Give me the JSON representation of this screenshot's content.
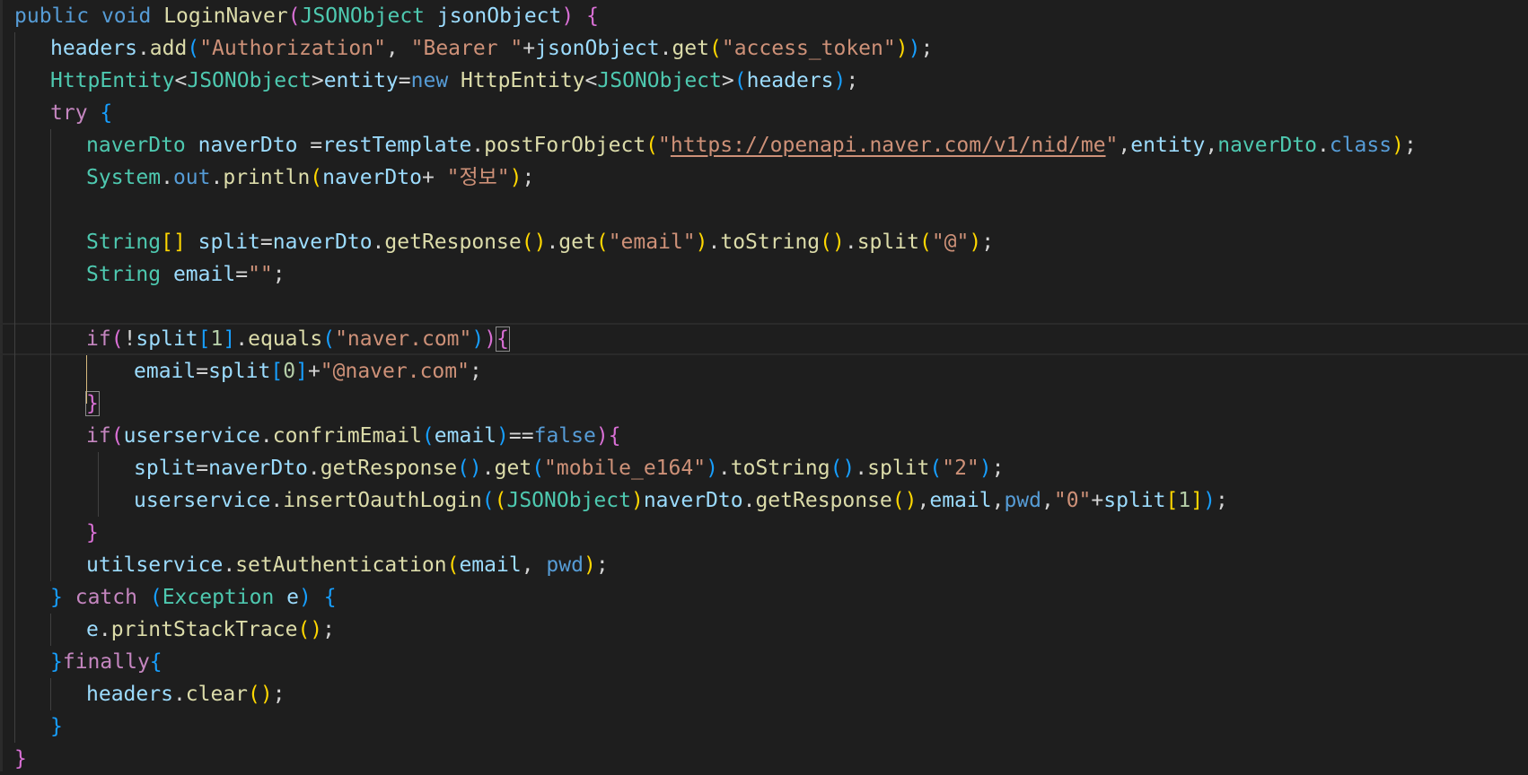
{
  "editor": {
    "language": "java",
    "theme": {
      "background": "#1e1e1e",
      "keyword": "#569cd6",
      "control": "#c586c0",
      "type": "#4ec9b0",
      "function": "#dcdcaa",
      "variable": "#9cdcfe",
      "string": "#ce9178",
      "number": "#b5cea8",
      "default": "#d4d4d4",
      "bracket1": "#ffd700",
      "bracket2": "#da70d6",
      "bracket3": "#179fff"
    },
    "lines": [
      {
        "indent": 0,
        "tokens": [
          {
            "t": "public",
            "c": "keyword"
          },
          {
            "t": " "
          },
          {
            "t": "void",
            "c": "keyword"
          },
          {
            "t": " "
          },
          {
            "t": "LoginNaver",
            "c": "function"
          },
          {
            "t": "(",
            "c": "bracket2"
          },
          {
            "t": "JSONObject",
            "c": "type"
          },
          {
            "t": " "
          },
          {
            "t": "jsonObject",
            "c": "variable"
          },
          {
            "t": ")",
            "c": "bracket2"
          },
          {
            "t": " "
          },
          {
            "t": "{",
            "c": "bracket2"
          }
        ]
      },
      {
        "indent": 1,
        "tokens": [
          {
            "t": "headers",
            "c": "variable"
          },
          {
            "t": "."
          },
          {
            "t": "add",
            "c": "function"
          },
          {
            "t": "(",
            "c": "bracket3"
          },
          {
            "t": "\"Authorization\"",
            "c": "string"
          },
          {
            "t": ", "
          },
          {
            "t": "\"Bearer \"",
            "c": "string"
          },
          {
            "t": "+"
          },
          {
            "t": "jsonObject",
            "c": "variable"
          },
          {
            "t": "."
          },
          {
            "t": "get",
            "c": "function"
          },
          {
            "t": "(",
            "c": "bracket1"
          },
          {
            "t": "\"access_token\"",
            "c": "string"
          },
          {
            "t": ")",
            "c": "bracket1"
          },
          {
            "t": ")",
            "c": "bracket3"
          },
          {
            "t": ";"
          }
        ]
      },
      {
        "indent": 1,
        "tokens": [
          {
            "t": "HttpEntity",
            "c": "type"
          },
          {
            "t": "<"
          },
          {
            "t": "JSONObject",
            "c": "type"
          },
          {
            "t": ">"
          },
          {
            "t": "entity",
            "c": "variable"
          },
          {
            "t": "="
          },
          {
            "t": "new",
            "c": "keyword"
          },
          {
            "t": " "
          },
          {
            "t": "HttpEntity",
            "c": "function"
          },
          {
            "t": "<"
          },
          {
            "t": "JSONObject",
            "c": "type"
          },
          {
            "t": ">"
          },
          {
            "t": "(",
            "c": "bracket3"
          },
          {
            "t": "headers",
            "c": "variable"
          },
          {
            "t": ")",
            "c": "bracket3"
          },
          {
            "t": ";"
          }
        ]
      },
      {
        "indent": 1,
        "tokens": [
          {
            "t": "try",
            "c": "control"
          },
          {
            "t": " "
          },
          {
            "t": "{",
            "c": "bracket3"
          }
        ]
      },
      {
        "indent": 2,
        "tokens": [
          {
            "t": "naverDto",
            "c": "type"
          },
          {
            "t": " "
          },
          {
            "t": "naverDto",
            "c": "variable"
          },
          {
            "t": " ="
          },
          {
            "t": "restTemplate",
            "c": "variable"
          },
          {
            "t": "."
          },
          {
            "t": "postForObject",
            "c": "function"
          },
          {
            "t": "(",
            "c": "bracket1"
          },
          {
            "t": "\"",
            "c": "string"
          },
          {
            "t": "https://openapi.naver.com/v1/nid/me",
            "c": "string",
            "u": true
          },
          {
            "t": "\"",
            "c": "string"
          },
          {
            "t": ","
          },
          {
            "t": "entity",
            "c": "variable"
          },
          {
            "t": ","
          },
          {
            "t": "naverDto",
            "c": "type"
          },
          {
            "t": "."
          },
          {
            "t": "class",
            "c": "keyword"
          },
          {
            "t": ")",
            "c": "bracket1"
          },
          {
            "t": ";"
          }
        ]
      },
      {
        "indent": 2,
        "tokens": [
          {
            "t": "System",
            "c": "type"
          },
          {
            "t": "."
          },
          {
            "t": "out",
            "c": "keyword"
          },
          {
            "t": "."
          },
          {
            "t": "println",
            "c": "function"
          },
          {
            "t": "(",
            "c": "bracket1"
          },
          {
            "t": "naverDto",
            "c": "variable"
          },
          {
            "t": "+ "
          },
          {
            "t": "\"정보\"",
            "c": "string"
          },
          {
            "t": ")",
            "c": "bracket1"
          },
          {
            "t": ";"
          }
        ]
      },
      {
        "indent": 2,
        "tokens": []
      },
      {
        "indent": 2,
        "tokens": [
          {
            "t": "String",
            "c": "type"
          },
          {
            "t": "[]",
            "c": "bracket1"
          },
          {
            "t": " "
          },
          {
            "t": "split",
            "c": "variable"
          },
          {
            "t": "="
          },
          {
            "t": "naverDto",
            "c": "variable"
          },
          {
            "t": "."
          },
          {
            "t": "getResponse",
            "c": "function"
          },
          {
            "t": "()",
            "c": "bracket1"
          },
          {
            "t": "."
          },
          {
            "t": "get",
            "c": "function"
          },
          {
            "t": "(",
            "c": "bracket1"
          },
          {
            "t": "\"email\"",
            "c": "string"
          },
          {
            "t": ")",
            "c": "bracket1"
          },
          {
            "t": "."
          },
          {
            "t": "toString",
            "c": "function"
          },
          {
            "t": "()",
            "c": "bracket1"
          },
          {
            "t": "."
          },
          {
            "t": "split",
            "c": "function"
          },
          {
            "t": "(",
            "c": "bracket1"
          },
          {
            "t": "\"@\"",
            "c": "string"
          },
          {
            "t": ")",
            "c": "bracket1"
          },
          {
            "t": ";"
          }
        ]
      },
      {
        "indent": 2,
        "tokens": [
          {
            "t": "String",
            "c": "type"
          },
          {
            "t": " "
          },
          {
            "t": "email",
            "c": "variable"
          },
          {
            "t": "="
          },
          {
            "t": "\"\"",
            "c": "string"
          },
          {
            "t": ";"
          }
        ]
      },
      {
        "indent": 2,
        "tokens": []
      },
      {
        "indent": 2,
        "current": true,
        "tokens": [
          {
            "t": "if",
            "c": "control"
          },
          {
            "t": "(",
            "c": "bracket2"
          },
          {
            "t": "!"
          },
          {
            "t": "split",
            "c": "variable"
          },
          {
            "t": "[",
            "c": "bracket3"
          },
          {
            "t": "1",
            "c": "number"
          },
          {
            "t": "]",
            "c": "bracket3"
          },
          {
            "t": "."
          },
          {
            "t": "equals",
            "c": "function"
          },
          {
            "t": "(",
            "c": "bracket3"
          },
          {
            "t": "\"naver.com\"",
            "c": "string"
          },
          {
            "t": ")",
            "c": "bracket3"
          },
          {
            "t": ")",
            "c": "bracket2"
          },
          {
            "t": "{",
            "c": "bracket2",
            "box": true
          }
        ]
      },
      {
        "indent": 3,
        "tokens": [
          {
            "t": "email",
            "c": "variable"
          },
          {
            "t": "="
          },
          {
            "t": "split",
            "c": "variable"
          },
          {
            "t": "[",
            "c": "bracket3"
          },
          {
            "t": "0",
            "c": "number"
          },
          {
            "t": "]",
            "c": "bracket3"
          },
          {
            "t": "+"
          },
          {
            "t": "\"@naver.com\"",
            "c": "string"
          },
          {
            "t": ";"
          }
        ]
      },
      {
        "indent": 2,
        "tokens": [
          {
            "t": "}",
            "c": "bracket2",
            "box": true
          }
        ]
      },
      {
        "indent": 2,
        "tokens": [
          {
            "t": "if",
            "c": "control"
          },
          {
            "t": "(",
            "c": "bracket2"
          },
          {
            "t": "userservice",
            "c": "variable"
          },
          {
            "t": "."
          },
          {
            "t": "confrimEmail",
            "c": "function"
          },
          {
            "t": "(",
            "c": "bracket3"
          },
          {
            "t": "email",
            "c": "variable"
          },
          {
            "t": ")",
            "c": "bracket3"
          },
          {
            "t": "=="
          },
          {
            "t": "false",
            "c": "keyword"
          },
          {
            "t": ")",
            "c": "bracket2"
          },
          {
            "t": "{",
            "c": "bracket2"
          }
        ]
      },
      {
        "indent": 3,
        "tokens": [
          {
            "t": "split",
            "c": "variable"
          },
          {
            "t": "="
          },
          {
            "t": "naverDto",
            "c": "variable"
          },
          {
            "t": "."
          },
          {
            "t": "getResponse",
            "c": "function"
          },
          {
            "t": "()",
            "c": "bracket3"
          },
          {
            "t": "."
          },
          {
            "t": "get",
            "c": "function"
          },
          {
            "t": "(",
            "c": "bracket3"
          },
          {
            "t": "\"mobile_e164\"",
            "c": "string"
          },
          {
            "t": ")",
            "c": "bracket3"
          },
          {
            "t": "."
          },
          {
            "t": "toString",
            "c": "function"
          },
          {
            "t": "()",
            "c": "bracket3"
          },
          {
            "t": "."
          },
          {
            "t": "split",
            "c": "function"
          },
          {
            "t": "(",
            "c": "bracket3"
          },
          {
            "t": "\"2\"",
            "c": "string"
          },
          {
            "t": ")",
            "c": "bracket3"
          },
          {
            "t": ";"
          }
        ]
      },
      {
        "indent": 3,
        "tokens": [
          {
            "t": "userservice",
            "c": "variable"
          },
          {
            "t": "."
          },
          {
            "t": "insertOauthLogin",
            "c": "function"
          },
          {
            "t": "(",
            "c": "bracket3"
          },
          {
            "t": "(",
            "c": "bracket1"
          },
          {
            "t": "JSONObject",
            "c": "type"
          },
          {
            "t": ")",
            "c": "bracket1"
          },
          {
            "t": "naverDto",
            "c": "variable"
          },
          {
            "t": "."
          },
          {
            "t": "getResponse",
            "c": "function"
          },
          {
            "t": "()",
            "c": "bracket1"
          },
          {
            "t": ","
          },
          {
            "t": "email",
            "c": "variable"
          },
          {
            "t": ","
          },
          {
            "t": "pwd",
            "c": "keyword"
          },
          {
            "t": ","
          },
          {
            "t": "\"0\"",
            "c": "string"
          },
          {
            "t": "+"
          },
          {
            "t": "split",
            "c": "variable"
          },
          {
            "t": "[",
            "c": "bracket1"
          },
          {
            "t": "1",
            "c": "number"
          },
          {
            "t": "]",
            "c": "bracket1"
          },
          {
            "t": ")",
            "c": "bracket3"
          },
          {
            "t": ";"
          }
        ]
      },
      {
        "indent": 2,
        "tokens": [
          {
            "t": "}",
            "c": "bracket2"
          }
        ]
      },
      {
        "indent": 2,
        "tokens": [
          {
            "t": "utilservice",
            "c": "variable"
          },
          {
            "t": "."
          },
          {
            "t": "setAuthentication",
            "c": "function"
          },
          {
            "t": "(",
            "c": "bracket1"
          },
          {
            "t": "email",
            "c": "variable"
          },
          {
            "t": ", "
          },
          {
            "t": "pwd",
            "c": "keyword"
          },
          {
            "t": ")",
            "c": "bracket1"
          },
          {
            "t": ";"
          }
        ]
      },
      {
        "indent": 1,
        "tokens": [
          {
            "t": "}",
            "c": "bracket3"
          },
          {
            "t": " "
          },
          {
            "t": "catch",
            "c": "control"
          },
          {
            "t": " "
          },
          {
            "t": "(",
            "c": "bracket3"
          },
          {
            "t": "Exception",
            "c": "type"
          },
          {
            "t": " "
          },
          {
            "t": "e",
            "c": "variable"
          },
          {
            "t": ")",
            "c": "bracket3"
          },
          {
            "t": " "
          },
          {
            "t": "{",
            "c": "bracket3"
          }
        ]
      },
      {
        "indent": 2,
        "tokens": [
          {
            "t": "e",
            "c": "variable"
          },
          {
            "t": "."
          },
          {
            "t": "printStackTrace",
            "c": "function"
          },
          {
            "t": "()",
            "c": "bracket1"
          },
          {
            "t": ";"
          }
        ]
      },
      {
        "indent": 1,
        "tokens": [
          {
            "t": "}",
            "c": "bracket3"
          },
          {
            "t": "finally",
            "c": "control"
          },
          {
            "t": "{",
            "c": "bracket3"
          }
        ]
      },
      {
        "indent": 2,
        "tokens": [
          {
            "t": "headers",
            "c": "variable"
          },
          {
            "t": "."
          },
          {
            "t": "clear",
            "c": "function"
          },
          {
            "t": "()",
            "c": "bracket1"
          },
          {
            "t": ";"
          }
        ]
      },
      {
        "indent": 1,
        "tokens": [
          {
            "t": "}",
            "c": "bracket3"
          }
        ]
      },
      {
        "indent": 0,
        "tokens": [
          {
            "t": "}",
            "c": "bracket2"
          }
        ]
      }
    ]
  }
}
